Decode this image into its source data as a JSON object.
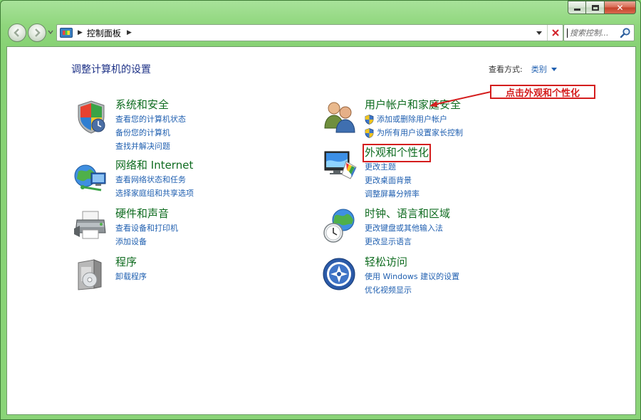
{
  "window": {
    "caption": {
      "close_glyph": "✕"
    }
  },
  "nav": {
    "address_text": "控制面板",
    "search_placeholder": "搜索控制..."
  },
  "content": {
    "title": "调整计算机的设置",
    "view_by_label": "查看方式:",
    "view_by_value": "类别"
  },
  "categories": {
    "system": {
      "title": "系统和安全",
      "links": [
        "查看您的计算机状态",
        "备份您的计算机",
        "查找并解决问题"
      ]
    },
    "network": {
      "title": "网络和 Internet",
      "links": [
        "查看网络状态和任务",
        "选择家庭组和共享选项"
      ]
    },
    "hardware": {
      "title": "硬件和声音",
      "links": [
        "查看设备和打印机",
        "添加设备"
      ]
    },
    "programs": {
      "title": "程序",
      "links": [
        "卸载程序"
      ]
    },
    "users": {
      "title": "用户帐户和家庭安全",
      "links": [
        "添加或删除用户帐户",
        "为所有用户设置家长控制"
      ]
    },
    "appearance": {
      "title": "外观和个性化",
      "links": [
        "更改主题",
        "更改桌面背景",
        "调整屏幕分辨率"
      ]
    },
    "clock": {
      "title": "时钟、语言和区域",
      "links": [
        "更改键盘或其他输入法",
        "更改显示语言"
      ]
    },
    "ease": {
      "title": "轻松访问",
      "links": [
        "使用 Windows 建议的设置",
        "优化视频显示"
      ]
    }
  },
  "annotation": {
    "text": "点击外观和个性化",
    "color": "#d41d1d"
  },
  "colors": {
    "category_title": "#0e6b1f",
    "link": "#1f5fb0",
    "page_title": "#1e3287",
    "frame": "#8ad478"
  }
}
